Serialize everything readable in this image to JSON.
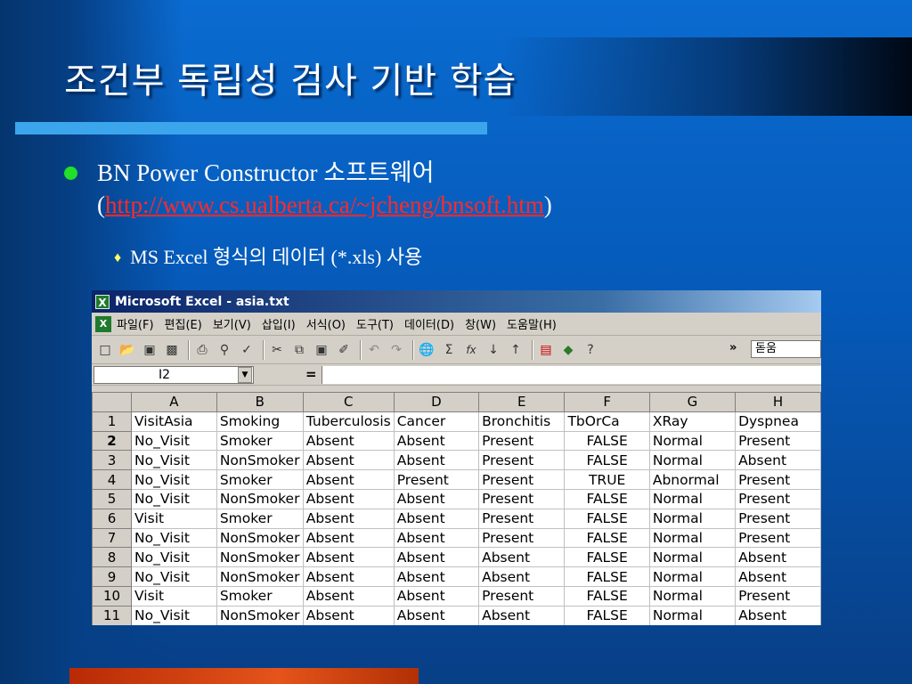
{
  "slide": {
    "title": "조건부 독립성 검사 기반 학습",
    "bullet1_text": "BN Power Constructor 소프트웨어",
    "bullet1_paren_open": "(",
    "bullet1_link": "http://www.cs.ualberta.ca/~jcheng/bnsoft.htm",
    "bullet1_paren_close": ")",
    "bullet2_marker": "♦",
    "bullet2_text": "MS Excel 형식의 데이터 (*.xls) 사용"
  },
  "excel": {
    "app_icon": "X",
    "window_title": "Microsoft Excel - asia.txt",
    "menu": [
      "파일(F)",
      "편집(E)",
      "보기(V)",
      "삽입(I)",
      "서식(O)",
      "도구(T)",
      "데이터(D)",
      "창(W)",
      "도움말(H)"
    ],
    "toolbar_icons": [
      "new-icon",
      "open-icon",
      "save-icon",
      "permission-icon",
      "print-icon",
      "print-preview-icon",
      "spelling-icon",
      "cut-icon",
      "copy-icon",
      "paste-icon",
      "format-painter-icon",
      "undo-icon",
      "redo-icon",
      "hyperlink-icon",
      "autosum-icon",
      "function-icon",
      "sort-ascending-icon",
      "sort-descending-icon",
      "chart-wizard-icon",
      "drawing-icon",
      "help-icon"
    ],
    "font_name": "돋움",
    "name_box": "I2",
    "formula_eq": "=",
    "column_headers": [
      "A",
      "B",
      "C",
      "D",
      "E",
      "F",
      "G",
      "H"
    ],
    "row_numbers": [
      "1",
      "2",
      "3",
      "4",
      "5",
      "6",
      "7",
      "8",
      "9",
      "10",
      "11"
    ],
    "rows": [
      [
        "VisitAsia",
        "Smoking",
        "Tuberculosis",
        "Cancer",
        "Bronchitis",
        "TbOrCa",
        "XRay",
        "Dyspnea"
      ],
      [
        "No_Visit",
        "Smoker",
        "Absent",
        "Absent",
        "Present",
        "FALSE",
        "Normal",
        "Present"
      ],
      [
        "No_Visit",
        "NonSmoker",
        "Absent",
        "Absent",
        "Present",
        "FALSE",
        "Normal",
        "Absent"
      ],
      [
        "No_Visit",
        "Smoker",
        "Absent",
        "Present",
        "Present",
        "TRUE",
        "Abnormal",
        "Present"
      ],
      [
        "No_Visit",
        "NonSmoker",
        "Absent",
        "Absent",
        "Present",
        "FALSE",
        "Normal",
        "Present"
      ],
      [
        "Visit",
        "Smoker",
        "Absent",
        "Absent",
        "Present",
        "FALSE",
        "Normal",
        "Present"
      ],
      [
        "No_Visit",
        "NonSmoker",
        "Absent",
        "Absent",
        "Present",
        "FALSE",
        "Normal",
        "Present"
      ],
      [
        "No_Visit",
        "NonSmoker",
        "Absent",
        "Absent",
        "Absent",
        "FALSE",
        "Normal",
        "Absent"
      ],
      [
        "No_Visit",
        "NonSmoker",
        "Absent",
        "Absent",
        "Absent",
        "FALSE",
        "Normal",
        "Absent"
      ],
      [
        "Visit",
        "Smoker",
        "Absent",
        "Absent",
        "Present",
        "FALSE",
        "Normal",
        "Present"
      ],
      [
        "No_Visit",
        "NonSmoker",
        "Absent",
        "Absent",
        "Absent",
        "FALSE",
        "Normal",
        "Absent"
      ]
    ]
  },
  "colors": {
    "slide_bg": "#0a6bd0",
    "bullet_dot": "#20e02a",
    "link": "#ff2a2a",
    "excel_title_start": "#0a246a"
  }
}
